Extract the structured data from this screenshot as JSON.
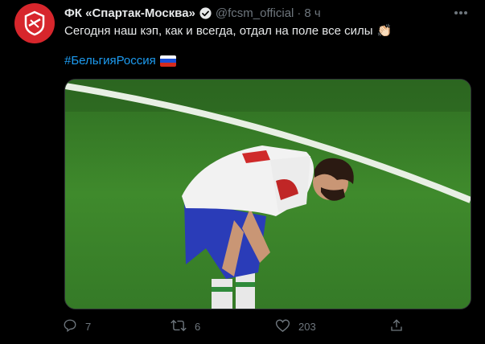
{
  "tweet": {
    "display_name": "ФК «Спартак-Москва»",
    "handle": "@fcsm_official",
    "separator": "·",
    "time": "8 ч",
    "text": "Сегодня наш кэп, как и всегда, отдал на поле все силы",
    "text_emoji": "👏🏻",
    "hashtag": "#БельгияРоссия",
    "hashtag_flag": "russia-flag"
  },
  "actions": {
    "reply_count": "7",
    "retweet_count": "6",
    "like_count": "203"
  },
  "colors": {
    "background": "#000000",
    "accent": "#1d9bf0",
    "muted": "#6e767d",
    "avatar": "#d7262c"
  },
  "icons": [
    "verified-badge-icon",
    "more-icon",
    "reply-icon",
    "retweet-icon",
    "like-icon",
    "share-icon"
  ]
}
